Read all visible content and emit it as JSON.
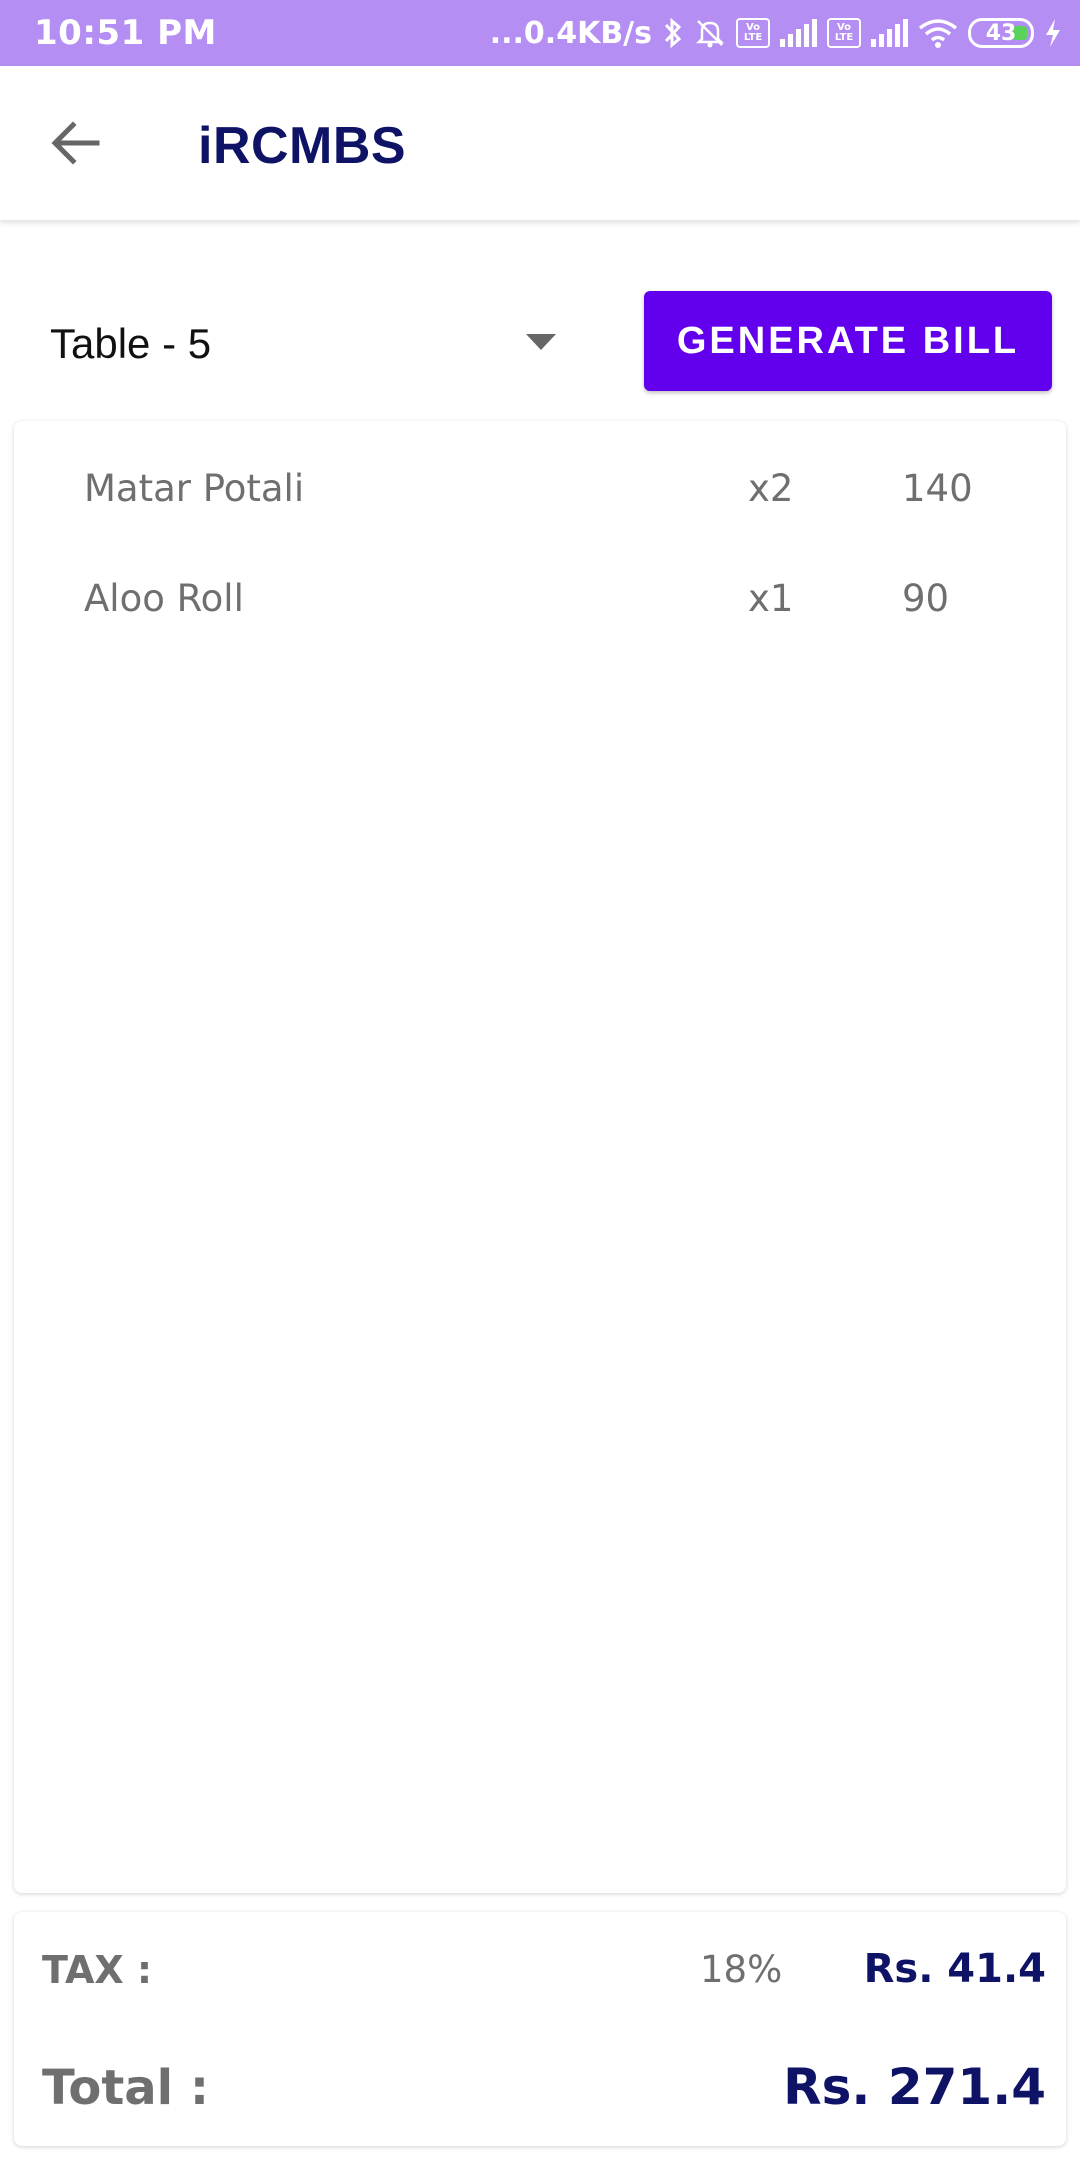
{
  "status_bar": {
    "time": "10:51 PM",
    "network_speed": "...0.4KB/s",
    "lte_badge_1": "Vo LTE",
    "lte_badge_2": "Vo LTE",
    "battery_level": "43",
    "icons": [
      "bluetooth-icon",
      "bell-off-icon",
      "signal-icon",
      "wifi-icon",
      "battery-icon",
      "charging-icon"
    ],
    "background_color": "#b48ef2"
  },
  "app_bar": {
    "title": "iRCMBS",
    "title_color": "#0f1366"
  },
  "toolbar": {
    "table_selected": "Table - 5",
    "generate_label": "GENERATE BILL",
    "accent_color": "#6200ee"
  },
  "order_items": [
    {
      "name": "Matar Potali",
      "qty": "x2",
      "price": "140"
    },
    {
      "name": "Aloo Roll",
      "qty": "x1",
      "price": "90"
    }
  ],
  "totals": {
    "tax_label": "TAX :",
    "tax_rate": "18%",
    "tax_amount": "Rs. 41.4",
    "total_label": "Total :",
    "total_amount": "Rs. 271.4"
  }
}
